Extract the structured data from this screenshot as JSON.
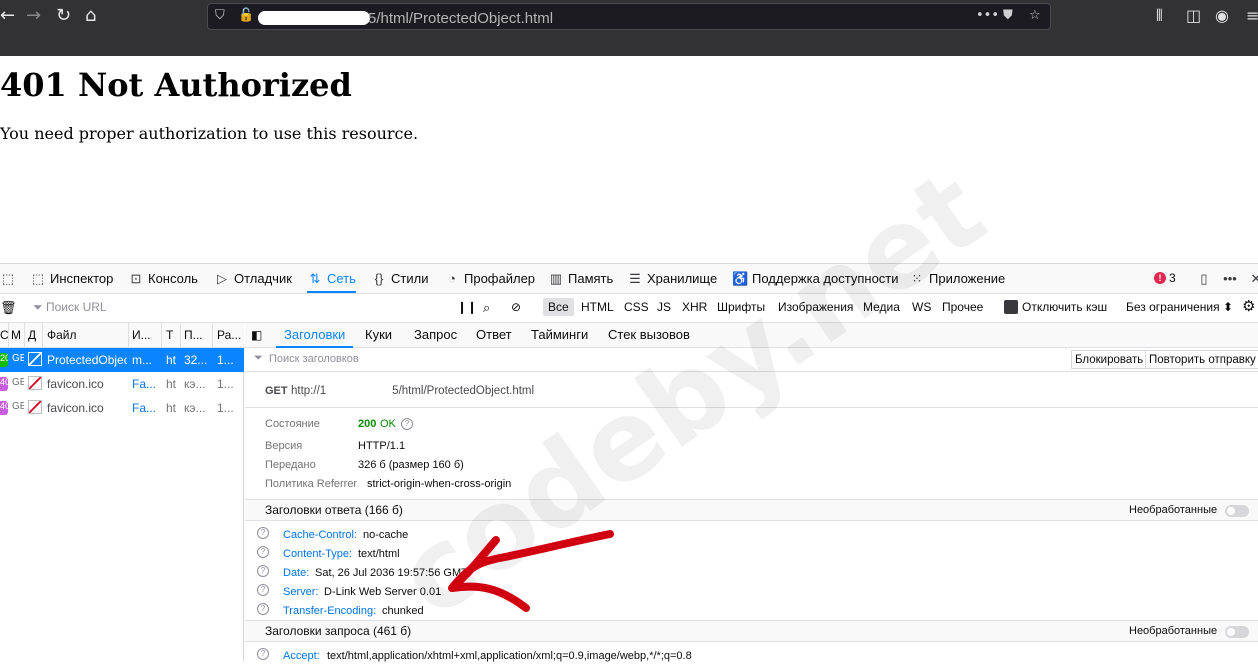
{
  "browser": {
    "url_suffix": "5/html/ProtectedObject.html"
  },
  "page": {
    "heading": "401 Not Authorized",
    "message": "You need proper authorization to use this resource."
  },
  "watermark": "codeby.net",
  "devtools": {
    "tabs": [
      {
        "label": "Инспектор",
        "icon": "inspector-icon"
      },
      {
        "label": "Консоль",
        "icon": "console-icon"
      },
      {
        "label": "Отладчик",
        "icon": "debugger-icon"
      },
      {
        "label": "Сеть",
        "icon": "network-icon",
        "selected": true
      },
      {
        "label": "Стили",
        "icon": "style-editor-icon"
      },
      {
        "label": "Профайлер",
        "icon": "profiler-icon"
      },
      {
        "label": "Память",
        "icon": "memory-icon"
      },
      {
        "label": "Хранилище",
        "icon": "storage-icon"
      },
      {
        "label": "Поддержка доступности",
        "icon": "accessibility-icon"
      },
      {
        "label": "Приложение",
        "icon": "application-icon"
      }
    ],
    "error_count": "3",
    "filter": {
      "url_placeholder": "Поиск URL",
      "types": [
        "Все",
        "HTML",
        "CSS",
        "JS",
        "XHR",
        "Шрифты",
        "Изображения",
        "Медиа",
        "WS",
        "Прочее"
      ],
      "disable_cache": "Отключить кэш",
      "throttling": "Без ограничения ⬍"
    },
    "request_list": {
      "headers": [
        "С",
        "М",
        "Д",
        "Файл",
        "И...",
        "Т",
        "П...",
        "Ра..."
      ],
      "rows": [
        {
          "status": "20",
          "method": "GE",
          "file": "ProtectedObject",
          "initiator": "m...",
          "type": "ht",
          "transferred": "32...",
          "size": "1...",
          "status_color": "#12bc00",
          "selected": true
        },
        {
          "status": "40",
          "method": "GE",
          "file": "favicon.ico",
          "initiator": "Fa...",
          "type": "ht",
          "transferred": "кэ...",
          "size": "1...",
          "status_color": "#c95ee0"
        },
        {
          "status": "40",
          "method": "GE",
          "file": "favicon.ico",
          "initiator": "Fa...",
          "type": "ht",
          "transferred": "кэ...",
          "size": "1...",
          "status_color": "#c95ee0"
        }
      ]
    },
    "details": {
      "tabs": [
        "Заголовки",
        "Куки",
        "Запрос",
        "Ответ",
        "Тайминги",
        "Стек вызовов"
      ],
      "filter_placeholder": "Поиск заголовков",
      "block_button": "Блокировать",
      "resend_button": "Повторить отправку",
      "summary": {
        "method": "GET",
        "url_start": "http://1",
        "url_end": "5/html/ProtectedObject.html"
      },
      "fields": [
        {
          "label": "Состояние",
          "value_code": "200",
          "value_text": "OK"
        },
        {
          "label": "Версия",
          "value": "HTTP/1.1"
        },
        {
          "label": "Передано",
          "value": "326 б (размер 160 б)"
        },
        {
          "label": "Политика Referrer",
          "value": "strict-origin-when-cross-origin"
        }
      ],
      "response_headers_title": "Заголовки ответа (166 б)",
      "raw_label": "Необработанные",
      "response_headers": [
        {
          "name": "Cache-Control:",
          "value": "no-cache"
        },
        {
          "name": "Content-Type:",
          "value": "text/html"
        },
        {
          "name": "Date:",
          "value": "Sat, 26 Jul 2036 19:57:56 GMT"
        },
        {
          "name": "Server:",
          "value": "D-Link Web Server 0.01"
        },
        {
          "name": "Transfer-Encoding:",
          "value": "chunked"
        }
      ],
      "request_headers_title": "Заголовки запроса (461 б)",
      "request_headers": [
        {
          "name": "Accept:",
          "value": "text/html,application/xhtml+xml,application/xml;q=0.9,image/webp,*/*;q=0.8"
        }
      ]
    }
  }
}
